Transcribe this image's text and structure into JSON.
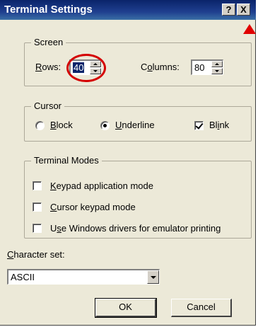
{
  "window": {
    "title": "Terminal Settings",
    "help_label": "?",
    "close_label": "X"
  },
  "screen": {
    "legend": "Screen",
    "rows_label_accel": "R",
    "rows_label_rest": "ows:",
    "rows_value": "40",
    "columns_label_pre": "C",
    "columns_label_accel": "o",
    "columns_label_rest": "lumns:",
    "columns_value": "80"
  },
  "cursor": {
    "legend": "Cursor",
    "options": [
      {
        "accel": "B",
        "rest": "lock",
        "selected": false
      },
      {
        "accel": "U",
        "rest": "nderline",
        "selected": true
      }
    ],
    "blink_pre": "Bl",
    "blink_accel": "i",
    "blink_rest": "nk",
    "blink_checked": true
  },
  "terminal_modes": {
    "legend": "Terminal Modes",
    "items": [
      {
        "accel": "K",
        "rest": "eypad application mode",
        "checked": false
      },
      {
        "accel": "C",
        "rest": "ursor keypad mode",
        "checked": false
      },
      {
        "pre": "U",
        "accel": "s",
        "rest": "e Windows drivers for emulator printing",
        "checked": false
      }
    ]
  },
  "charset": {
    "label_accel": "C",
    "label_rest": "haracter set:",
    "value": "ASCII"
  },
  "buttons": {
    "ok": "OK",
    "cancel": "Cancel"
  },
  "colors": {
    "annotation": "#d40000",
    "titlebar": "#0a246a",
    "dialog": "#ece9d8"
  }
}
